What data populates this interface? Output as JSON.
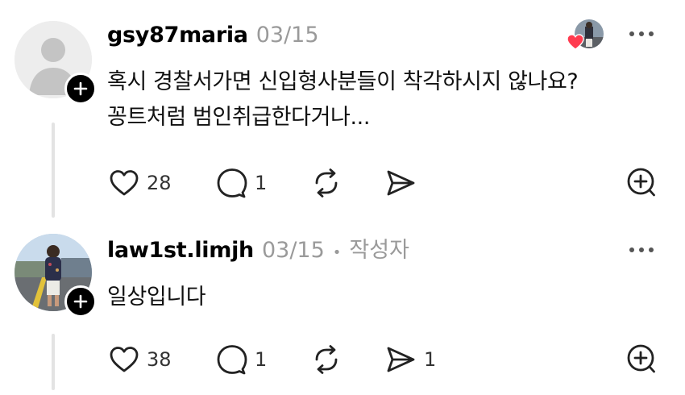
{
  "colors": {
    "accent_heart": "#ff3b4f",
    "meta_gray": "#9a9a9a",
    "line_gray": "#e3e3e3"
  },
  "comments": [
    {
      "username": "gsy87maria",
      "date": "03/15",
      "text_lines": [
        "혹시 경찰서가면 신입형사분들이 착각하시지 않나요?",
        "꽁트처럼 범인취급한다거나..."
      ],
      "likes": "28",
      "replies": "1",
      "reposts": "",
      "shares": ""
    },
    {
      "username": "law1st.limjh",
      "date": "03/15",
      "separator": "•",
      "author_badge": "작성자",
      "text_lines": [
        "일상입니다"
      ],
      "likes": "38",
      "replies": "1",
      "reposts": "",
      "shares": "1"
    }
  ],
  "icons": {
    "more": "more-horizontal-icon",
    "heart": "heart-icon",
    "reply": "reply-bubble-icon",
    "repost": "repost-icon",
    "share": "share-send-icon",
    "add": "add-circle-icon"
  }
}
